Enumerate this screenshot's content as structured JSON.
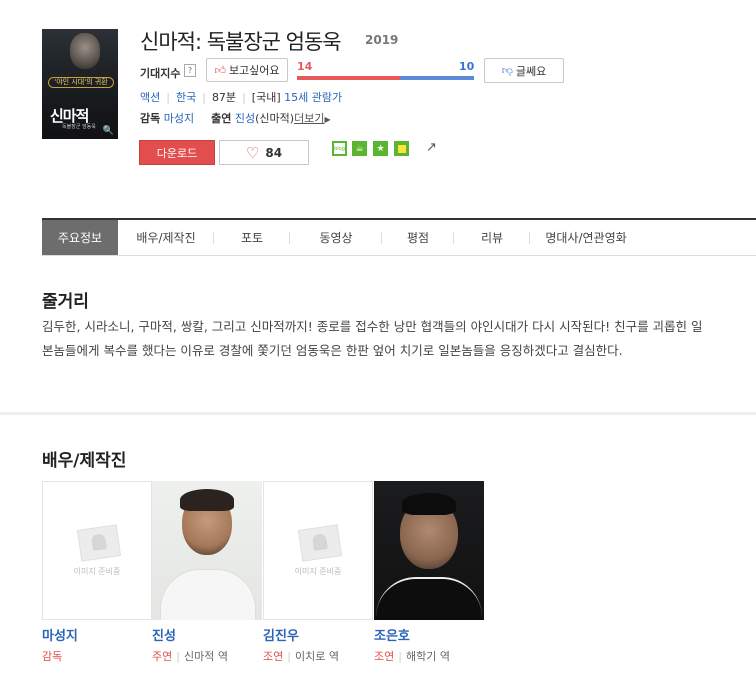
{
  "movie": {
    "title": "신마적: 독불장군 엄동욱",
    "year": "2019",
    "poster": {
      "caption": "'야인 시대'의 귀환",
      "title": "신마적",
      "subtitle": "독불장군 엄동욱"
    }
  },
  "rating": {
    "label": "기대지수",
    "help": "?",
    "want_label": "보고싶어요",
    "want_count": "14",
    "not_want_label": "글쎄요",
    "not_want_count": "10",
    "want_fraction": 0.58
  },
  "info": {
    "genre": "액션",
    "country": "한국",
    "runtime": "87분",
    "rating_prefix": "[국내]",
    "rating": "15세 관람가",
    "director_label": "감독",
    "director": "마성지",
    "cast_label": "출연",
    "cast_name": "진성",
    "cast_role": "(신마적)",
    "more": "더보기"
  },
  "actions": {
    "download": "다운로드",
    "like_count": "84",
    "blog": "blog"
  },
  "tabs": [
    "주요정보",
    "배우/제작진",
    "포토",
    "동영상",
    "평점",
    "리뷰",
    "명대사/연관영화"
  ],
  "synopsis": {
    "title": "줄거리",
    "text": "김두한, 시라소니, 구마적, 쌍칼, 그리고 신마적까지! 종로를 접수한 낭만 협객들의 야인시대가 다시 시작된다! 친구를 괴롭힌 일본놈들에게 복수를 했다는 이유로 경찰에 쫓기던 엄동욱은 한판 엎어 치기로 일본놈들을 응징하겠다고 결심한다."
  },
  "cast_section": {
    "title": "배우/제작진",
    "placeholder_text": "이미지 준비중",
    "people": [
      {
        "name": "마성지",
        "role": "감독",
        "character": ""
      },
      {
        "name": "진성",
        "role": "주연",
        "character": "신마적 역"
      },
      {
        "name": "김진우",
        "role": "조연",
        "character": "이치로 역"
      },
      {
        "name": "조은호",
        "role": "조연",
        "character": "해학기 역"
      }
    ]
  },
  "colors": {
    "accent_red": "#e24e4e",
    "link_blue": "#2a64b8",
    "share_green": "#5ab531"
  }
}
